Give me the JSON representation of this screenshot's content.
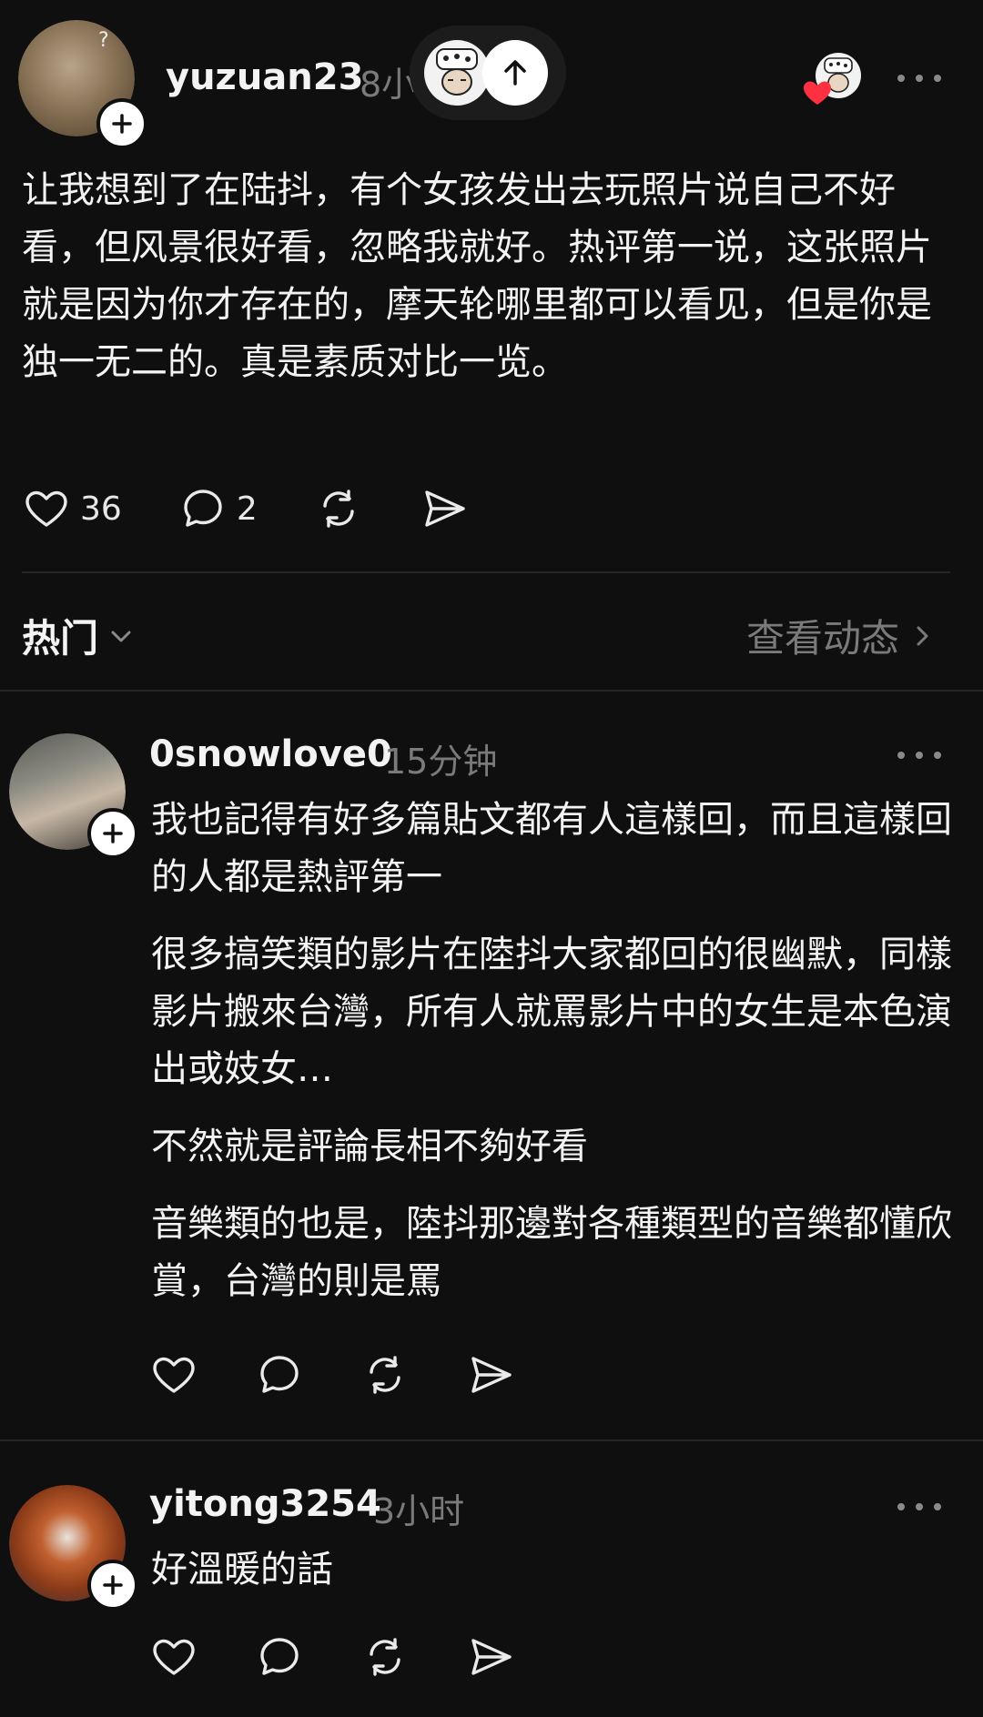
{
  "post": {
    "username": "yuzuan23",
    "time": "8小",
    "text": "让我想到了在陆抖，有个女孩发出去玩照片说自己不好看，但风景很好看，忽略我就好。热评第一说，这张照片就是因为你才存在的，摩天轮哪里都可以看见，但是你是独一无二的。真是素质对比一览。",
    "likes": "36",
    "comments": "2"
  },
  "section": {
    "sort_label": "热门",
    "view_activity": "查看动态"
  },
  "replies": [
    {
      "username": "0snowlove0",
      "time": "15分钟",
      "paragraphs": [
        "我也記得有好多篇貼文都有人這樣回，而且這樣回的人都是熱評第一",
        "很多搞笑類的影片在陸抖大家都回的很幽默，同樣影片搬來台灣，所有人就罵影片中的女生是本色演出或妓女…",
        "不然就是評論長相不夠好看",
        "音樂類的也是，陸抖那邊對各種類型的音樂都懂欣賞，台灣的則是罵"
      ]
    },
    {
      "username": "yitong3254",
      "time": "3小时",
      "paragraphs": [
        "好溫暖的話"
      ]
    }
  ],
  "colors": {
    "background": "#0f0f0f",
    "text": "#f3f3f3",
    "secondary": "#7a7a7a",
    "heart_badge": "#ff3040"
  }
}
